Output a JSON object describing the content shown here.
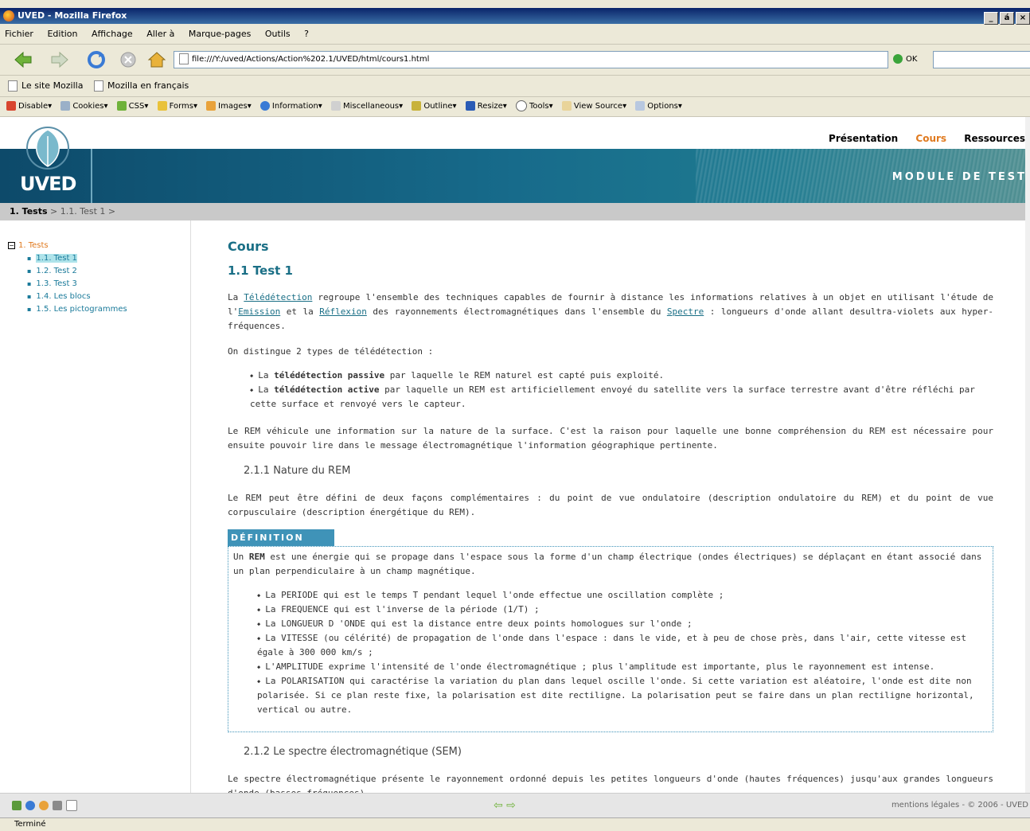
{
  "window": {
    "title": "UVED - Mozilla Firefox",
    "controls": [
      "_",
      "á",
      "×"
    ]
  },
  "menu": [
    "Fichier",
    "Edition",
    "Affichage",
    "Aller à",
    "Marque-pages",
    "Outils",
    "?"
  ],
  "nav": {
    "url": "file:///Y:/uved/Actions/Action%202.1/UVED/html/cours1.html",
    "go_label": "OK"
  },
  "bookmarks": [
    "Le site Mozilla",
    "Mozilla en français"
  ],
  "devtools": [
    "Disable▾",
    "Cookies▾",
    "CSS▾",
    "Forms▾",
    "Images▾",
    "Information▾",
    "Miscellaneous▾",
    "Outline▾",
    "Resize▾",
    "Tools▾",
    "View Source▾",
    "Options▾"
  ],
  "site": {
    "logo_text": "UVED",
    "topnav": [
      "Présentation",
      "Cours",
      "Ressources"
    ],
    "active_nav": "Cours",
    "banner": "MODULE DE TEST",
    "breadcrumb": {
      "first": "1. Tests",
      "rest": " > 1.1. Test 1 >"
    }
  },
  "tree": {
    "root": "1. Tests",
    "items": [
      "1.1. Test 1",
      "1.2. Test 2",
      "1.3. Test 3",
      "1.4. Les blocs",
      "1.5. Les pictogrammes"
    ],
    "selected": 0
  },
  "content": {
    "title": "Cours",
    "subtitle": "1.1 Test 1",
    "p1_a": "La ",
    "p1_link1": "Télédétection",
    "p1_b": " regroupe l'ensemble des techniques capables de fournir à distance les informations relatives à un objet en utilisant l'étude de l'",
    "p1_link2": "Emission",
    "p1_c": " et la ",
    "p1_link3": "Réflexion",
    "p1_d": " des rayonnements électromagnétiques dans l'ensemble du ",
    "p1_link4": "Spectre",
    "p1_e": " : longueurs d'onde allant desultra-violets aux hyper-fréquences.",
    "p2": "On distingue 2 types de télédétection :",
    "b1_a": "La ",
    "b1_bold": "télédétection passive",
    "b1_c": " par laquelle le REM naturel est capté puis exploité.",
    "b2_a": "La ",
    "b2_bold": "télédétection active",
    "b2_c": " par laquelle un REM est artificiellement envoyé du satellite vers la surface terrestre avant d'être réfléchi par cette surface et renvoyé vers le capteur.",
    "p3": "Le REM véhicule une information sur la nature de la surface. C'est la raison pour laquelle une bonne compréhension du REM est nécessaire pour ensuite pouvoir lire dans le message électromagnétique l'information géographique pertinente.",
    "h3_1": "2.1.1 Nature du REM",
    "p4": "Le REM peut être défini de deux façons complémentaires : du point de vue ondulatoire (description ondulatoire du REM) et du point de vue corpusculaire (description énergétique du REM).",
    "def_label": "DÉFINITION",
    "def_a": "Un ",
    "def_bold": "REM",
    "def_c": " est une énergie qui se propage dans l'espace sous la forme d'un champ électrique (ondes électriques) se déplaçant en étant associé dans un plan perpendiculaire à un champ magnétique.",
    "def_items": [
      "La PERIODE qui est le temps T pendant lequel l'onde effectue une oscillation complète ;",
      "La FREQUENCE qui est l'inverse de la période (1/T) ;",
      "La LONGUEUR D 'ONDE qui est la distance entre deux points homologues sur l'onde ;",
      "La VITESSE (ou célérité) de propagation de l'onde dans l'espace : dans le vide, et à peu de chose près, dans l'air, cette vitesse est égale à 300 000 km/s ;",
      "L'AMPLITUDE exprime l'intensité de l'onde électromagnétique ; plus l'amplitude est importante, plus le rayonnement est intense.",
      "La POLARISATION qui caractérise la variation du plan dans lequel oscille l'onde. Si cette variation est aléatoire, l'onde est dite non polarisée. Si ce plan reste fixe, la polarisation est dite rectiligne. La polarisation peut se faire dans un plan rectiligne horizontal, vertical ou autre."
    ],
    "h3_2": "2.1.2 Le spectre électromagnétique (SEM)",
    "p5": "Le spectre électromagnétique présente le rayonnement ordonné depuis les petites longueurs d'onde (hautes fréquences) jusqu'aux grandes longueurs d'onde (basses fréquences)."
  },
  "footer": {
    "arrows": "⇦ ⇨",
    "legal": "mentions légales - © 2006 - UVED"
  },
  "status": "Terminé",
  "colors": {
    "accent": "#1a6f86",
    "active": "#e07a1f",
    "definition": "#3f93b8"
  }
}
